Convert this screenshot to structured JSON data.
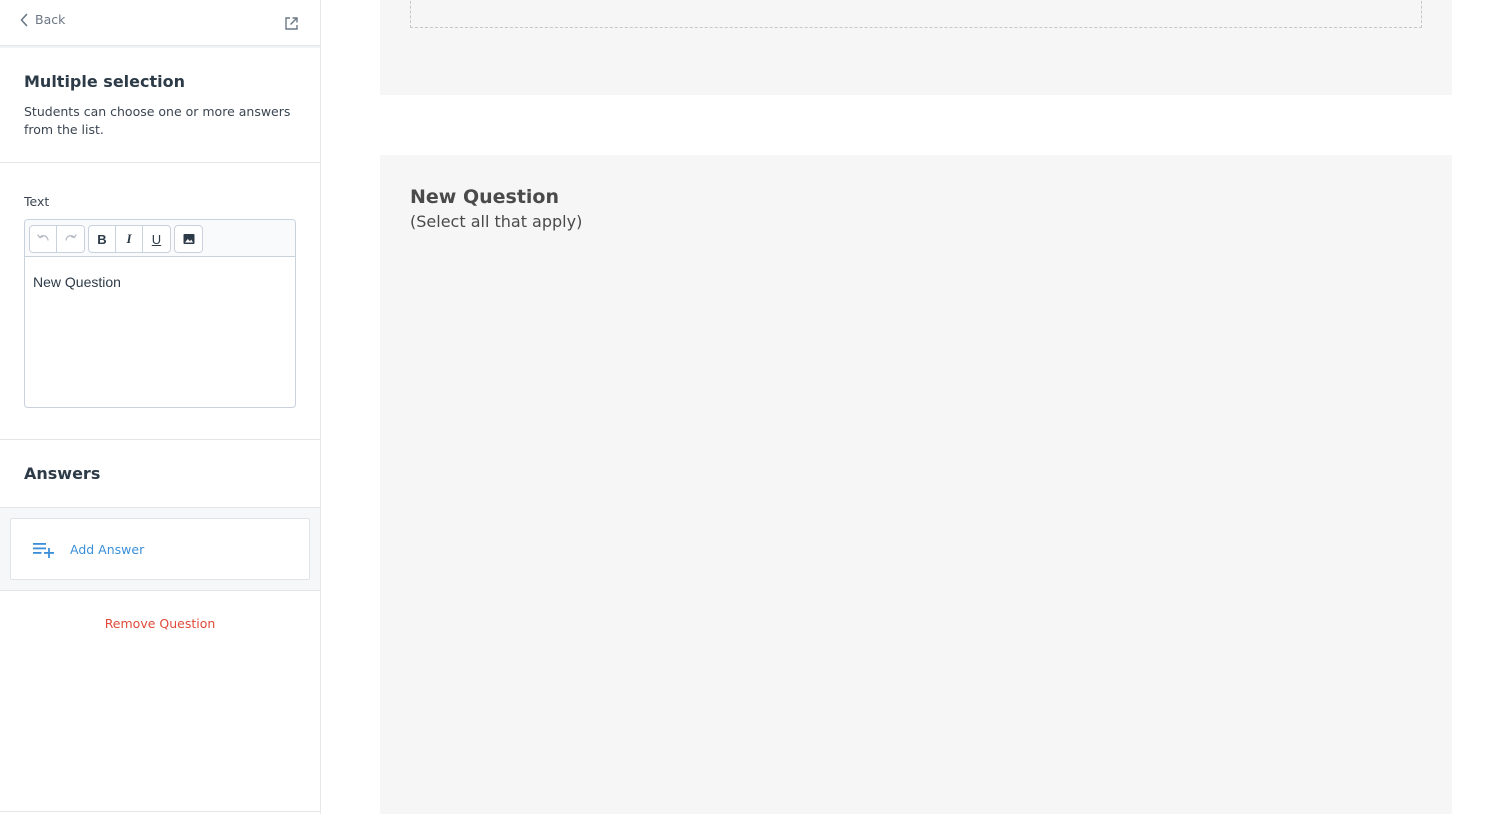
{
  "sidebar": {
    "back_label": "Back",
    "title": "Multiple selection",
    "description": "Students can choose one or more answers from the list.",
    "text_label": "Text",
    "toolbar": {
      "bold": "B",
      "italic": "I",
      "underline": "U"
    },
    "editor_content": "New Question",
    "answers_title": "Answers",
    "add_answer_label": "Add Answer",
    "remove_question_label": "Remove Question"
  },
  "canvas": {
    "question_title": "New Question",
    "question_subtitle": "(Select all that apply)"
  },
  "icons": {
    "back": "chevron-left-icon",
    "popout": "external-link-icon",
    "undo": "undo-icon",
    "redo": "redo-icon",
    "image": "image-icon",
    "add_list": "playlist-add-icon"
  },
  "colors": {
    "link_blue": "#3a8fd8",
    "danger_red": "#e04a3a",
    "canvas_bg": "#f6f6f6"
  }
}
